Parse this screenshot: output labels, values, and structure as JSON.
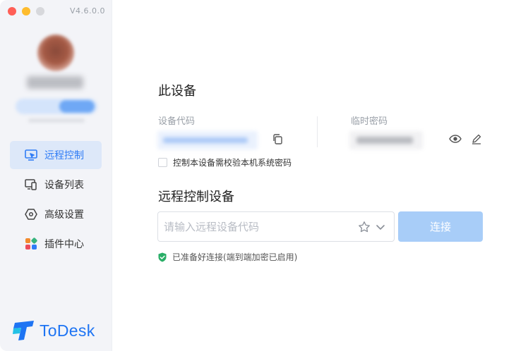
{
  "app": {
    "version": "V4.6.0.0",
    "logo_text": "ToDesk"
  },
  "sidebar": {
    "items": [
      {
        "label": "远程控制",
        "icon": "remote-control-icon",
        "active": true
      },
      {
        "label": "设备列表",
        "icon": "device-list-icon",
        "active": false
      },
      {
        "label": "高级设置",
        "icon": "settings-hexagon-icon",
        "active": false
      },
      {
        "label": "插件中心",
        "icon": "plugin-grid-icon",
        "active": false
      }
    ]
  },
  "this_device": {
    "title": "此设备",
    "code_label": "设备代码",
    "password_label": "临时密码",
    "verify_checkbox_label": "控制本设备需校验本机系统密码"
  },
  "remote": {
    "title": "远程控制设备",
    "input_placeholder": "请输入远程设备代码",
    "input_value": "",
    "connect_label": "连接",
    "status_text": "已准备好连接(端到端加密已启用)"
  },
  "colors": {
    "accent": "#2f7cf6",
    "connect_disabled": "#a8cdf8",
    "status_ok": "#2aae67"
  }
}
